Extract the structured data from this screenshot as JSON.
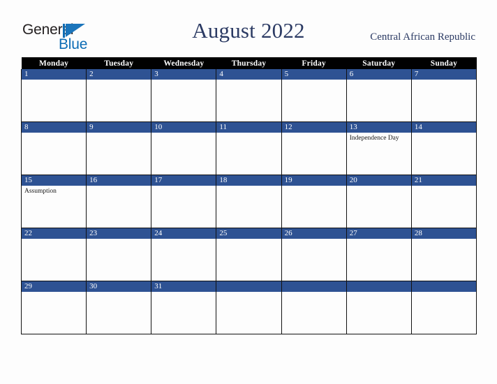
{
  "branding": {
    "logo_text_top": "General",
    "logo_text_bottom": "Blue",
    "logo_color_dark": "#231f20",
    "logo_color_blue": "#0c6cb5"
  },
  "header": {
    "title": "August 2022",
    "country": "Central African Republic",
    "title_color": "#2b3a63"
  },
  "calendar": {
    "weekday_headers": [
      "Monday",
      "Tuesday",
      "Wednesday",
      "Thursday",
      "Friday",
      "Saturday",
      "Sunday"
    ],
    "header_bg": "#010101",
    "daybar_bg": "#2e5293",
    "weeks": [
      [
        {
          "day": "1",
          "events": []
        },
        {
          "day": "2",
          "events": []
        },
        {
          "day": "3",
          "events": []
        },
        {
          "day": "4",
          "events": []
        },
        {
          "day": "5",
          "events": []
        },
        {
          "day": "6",
          "events": []
        },
        {
          "day": "7",
          "events": []
        }
      ],
      [
        {
          "day": "8",
          "events": []
        },
        {
          "day": "9",
          "events": []
        },
        {
          "day": "10",
          "events": []
        },
        {
          "day": "11",
          "events": []
        },
        {
          "day": "12",
          "events": []
        },
        {
          "day": "13",
          "events": [
            "Independence Day"
          ]
        },
        {
          "day": "14",
          "events": []
        }
      ],
      [
        {
          "day": "15",
          "events": [
            "Assumption"
          ]
        },
        {
          "day": "16",
          "events": []
        },
        {
          "day": "17",
          "events": []
        },
        {
          "day": "18",
          "events": []
        },
        {
          "day": "19",
          "events": []
        },
        {
          "day": "20",
          "events": []
        },
        {
          "day": "21",
          "events": []
        }
      ],
      [
        {
          "day": "22",
          "events": []
        },
        {
          "day": "23",
          "events": []
        },
        {
          "day": "24",
          "events": []
        },
        {
          "day": "25",
          "events": []
        },
        {
          "day": "26",
          "events": []
        },
        {
          "day": "27",
          "events": []
        },
        {
          "day": "28",
          "events": []
        }
      ],
      [
        {
          "day": "29",
          "events": []
        },
        {
          "day": "30",
          "events": []
        },
        {
          "day": "31",
          "events": []
        },
        {
          "day": "",
          "events": []
        },
        {
          "day": "",
          "events": []
        },
        {
          "day": "",
          "events": []
        },
        {
          "day": "",
          "events": []
        }
      ]
    ]
  }
}
